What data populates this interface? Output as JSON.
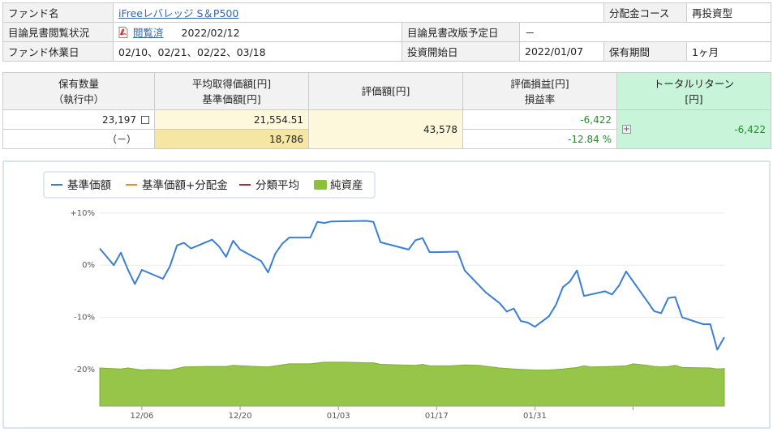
{
  "info": {
    "fund_name_label": "ファンド名",
    "fund_name": "iFreeレバレッジ S＆P500",
    "dividend_course_label": "分配金コース",
    "dividend_course": "再投資型",
    "prospectus_status_label": "目論見書閲覧状況",
    "prospectus_status": "閲覧済",
    "prospectus_date": "2022/02/12",
    "prospectus_revision_label": "目論見書改版予定日",
    "prospectus_revision": "－",
    "holiday_label": "ファンド休業日",
    "holidays": "02/10、02/21、02/22、03/18",
    "start_label": "投資開始日",
    "start_date": "2022/01/07",
    "holding_period_label": "保有期間",
    "holding_period": "1ヶ月"
  },
  "holdings": {
    "headers": {
      "qty_1": "保有数量",
      "qty_2": "（執行中）",
      "avg_1": "平均取得価額[円]",
      "avg_2": "基準価額[円]",
      "val": "評価額[円]",
      "pl_1": "評価損益[円]",
      "pl_2": "損益率",
      "tr_1": "トータルリターン",
      "tr_2": "[円]"
    },
    "quantity": "23,197",
    "executing": "（－）",
    "avg_price": "21,554.51",
    "nav": "18,786",
    "valuation": "43,578",
    "pl": "-6,422",
    "pl_rate": "-12.84 %",
    "total_return": "-6,422"
  },
  "chart_data": {
    "type": "line",
    "legend": [
      "基準価額",
      "基準価額+分配金",
      "分類平均",
      "純資産"
    ],
    "legend_colors": [
      "#3a7fd5",
      "#ef8a25",
      "#a3303a",
      "#8dc03a"
    ],
    "y_ticks": [
      "+10%",
      "0%",
      "-10%",
      "-20%"
    ],
    "y_tick_values": [
      10,
      0,
      -10,
      -20
    ],
    "x_ticks": [
      "12/06",
      "12/20",
      "01/03",
      "01/17",
      "01/31"
    ],
    "x_tick_days": [
      6,
      20,
      34,
      48,
      62
    ],
    "ylim": [
      -27,
      12
    ],
    "xlim": [
      0,
      89
    ],
    "series": [
      {
        "name": "基準価額",
        "color": "#3a7fd5",
        "points": [
          [
            0,
            3.2
          ],
          [
            2,
            0.0
          ],
          [
            3,
            2.4
          ],
          [
            4,
            -0.8
          ],
          [
            5,
            -3.6
          ],
          [
            6,
            -0.9
          ],
          [
            9,
            -2.6
          ],
          [
            10,
            -0.2
          ],
          [
            11,
            3.8
          ],
          [
            12,
            4.3
          ],
          [
            13,
            3.2
          ],
          [
            16,
            4.9
          ],
          [
            17,
            3.6
          ],
          [
            18,
            1.6
          ],
          [
            19,
            4.7
          ],
          [
            20,
            3.0
          ],
          [
            23,
            0.8
          ],
          [
            24,
            -1.4
          ],
          [
            25,
            2.2
          ],
          [
            26,
            4.1
          ],
          [
            27,
            5.3
          ],
          [
            30,
            5.3
          ],
          [
            31,
            8.3
          ],
          [
            32,
            8.1
          ],
          [
            33,
            8.4
          ],
          [
            38,
            8.5
          ],
          [
            39,
            8.3
          ],
          [
            40,
            4.4
          ],
          [
            44,
            3.0
          ],
          [
            45,
            4.8
          ],
          [
            46,
            5.2
          ],
          [
            47,
            2.5
          ],
          [
            48,
            2.5
          ],
          [
            51,
            2.6
          ],
          [
            52,
            -1.0
          ],
          [
            55,
            -5.2
          ],
          [
            57,
            -7.3
          ],
          [
            58,
            -8.9
          ],
          [
            59,
            -8.3
          ],
          [
            60,
            -10.7
          ],
          [
            61,
            -11.0
          ],
          [
            62,
            -11.8
          ],
          [
            64,
            -9.8
          ],
          [
            65,
            -7.6
          ],
          [
            66,
            -4.2
          ],
          [
            67,
            -3.1
          ],
          [
            68,
            -1.0
          ],
          [
            69,
            -5.9
          ],
          [
            72,
            -5.0
          ],
          [
            73,
            -5.6
          ],
          [
            74,
            -3.9
          ],
          [
            75,
            -1.2
          ],
          [
            78,
            -6.9
          ],
          [
            79,
            -8.8
          ],
          [
            80,
            -9.2
          ],
          [
            81,
            -6.3
          ],
          [
            82,
            -6.1
          ],
          [
            83,
            -10.0
          ],
          [
            86,
            -11.3
          ],
          [
            87,
            -11.3
          ],
          [
            88,
            -16.2
          ],
          [
            89,
            -13.8
          ]
        ]
      }
    ],
    "area": {
      "name": "純資産",
      "color": "#8dc03a",
      "points": [
        [
          0,
          -19.7
        ],
        [
          3,
          -19.9
        ],
        [
          4,
          -19.7
        ],
        [
          5,
          -19.9
        ],
        [
          6,
          -20.1
        ],
        [
          7,
          -20.0
        ],
        [
          10,
          -20.1
        ],
        [
          12,
          -19.5
        ],
        [
          15,
          -19.4
        ],
        [
          18,
          -19.4
        ],
        [
          19,
          -19.2
        ],
        [
          22,
          -19.4
        ],
        [
          24,
          -19.5
        ],
        [
          27,
          -18.9
        ],
        [
          30,
          -18.9
        ],
        [
          32,
          -18.6
        ],
        [
          35,
          -18.6
        ],
        [
          38,
          -18.7
        ],
        [
          39,
          -18.7
        ],
        [
          40,
          -19.0
        ],
        [
          45,
          -19.2
        ],
        [
          46,
          -19.0
        ],
        [
          47,
          -19.3
        ],
        [
          50,
          -19.3
        ],
        [
          52,
          -19.1
        ],
        [
          54,
          -19.2
        ],
        [
          57,
          -19.7
        ],
        [
          59,
          -19.9
        ],
        [
          62,
          -20.1
        ],
        [
          64,
          -20.1
        ],
        [
          66,
          -19.9
        ],
        [
          68,
          -19.6
        ],
        [
          69,
          -19.3
        ],
        [
          70,
          -19.5
        ],
        [
          73,
          -19.4
        ],
        [
          75,
          -19.3
        ],
        [
          76,
          -18.9
        ],
        [
          78,
          -19.2
        ],
        [
          79,
          -19.4
        ],
        [
          80,
          -19.5
        ],
        [
          81,
          -19.4
        ],
        [
          82,
          -19.2
        ],
        [
          83,
          -19.6
        ],
        [
          87,
          -19.7
        ],
        [
          88,
          -19.9
        ],
        [
          89,
          -19.8
        ]
      ]
    }
  }
}
